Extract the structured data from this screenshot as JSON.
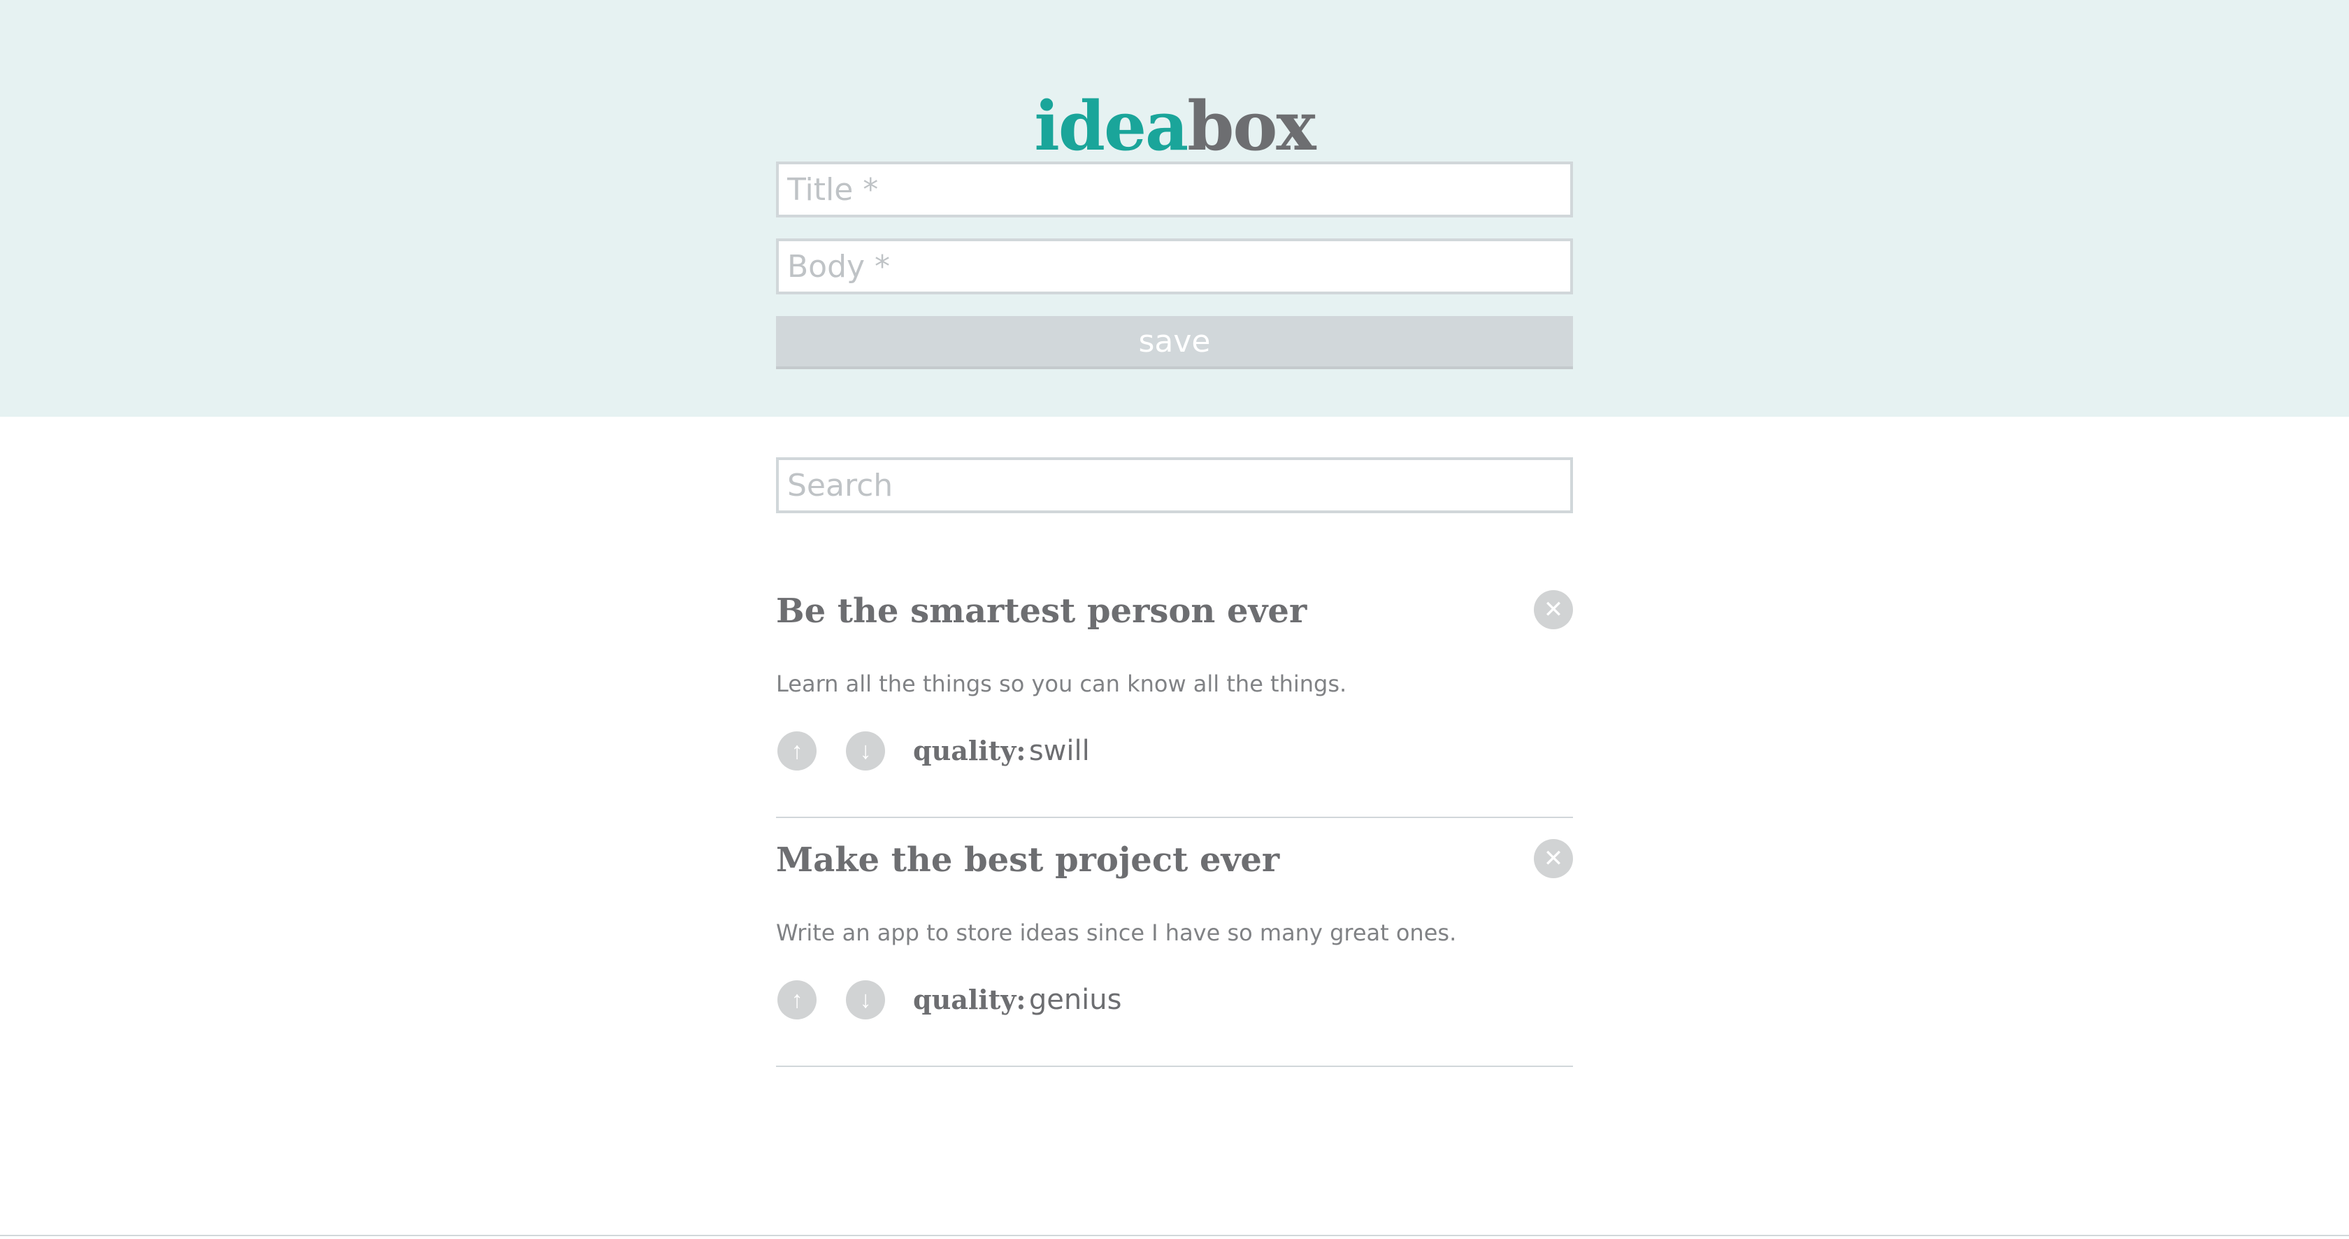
{
  "app": {
    "logo_part1": "idea",
    "logo_part2": "box"
  },
  "form": {
    "title_placeholder": "Title *",
    "title_value": "",
    "body_placeholder": "Body *",
    "body_value": "",
    "save_label": "save"
  },
  "search": {
    "placeholder": "Search",
    "value": ""
  },
  "ideas": [
    {
      "title": "Be the smartest person ever",
      "body": "Learn all the things so you can know all the things.",
      "quality_label": "quality:",
      "quality": "swill"
    },
    {
      "title": "Make the best project ever",
      "body": "Write an app to store ideas since I have so many great ones.",
      "quality_label": "quality:",
      "quality": "genius"
    }
  ],
  "icons": {
    "delete": "close-icon",
    "upvote": "arrow-up-icon",
    "downvote": "arrow-down-icon"
  },
  "colors": {
    "accent": "#1aa59a",
    "header_bg": "#e6f2f2",
    "text": "#6d6e71",
    "muted": "#d1d3d4"
  }
}
